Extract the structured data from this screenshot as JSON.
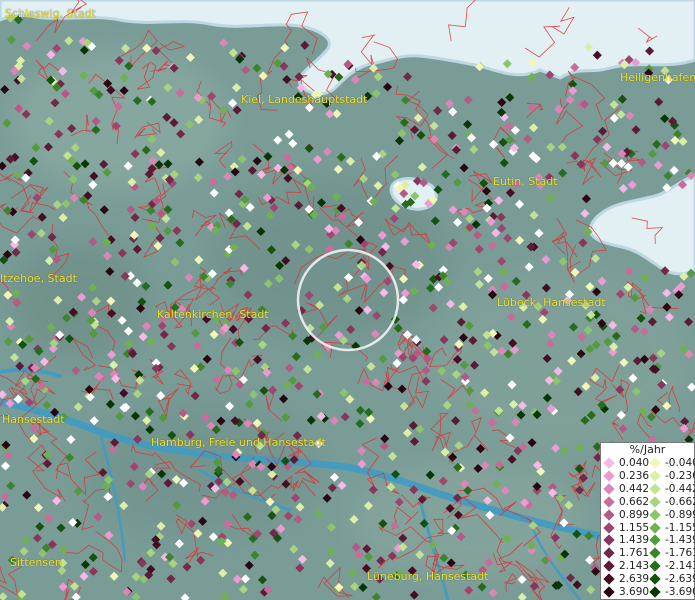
{
  "map": {
    "places": [
      {
        "name": "Schleswig, Stadt"
      },
      {
        "name": "Heiligenhafen, Stadt"
      },
      {
        "name": "Kiel, Landeshauptstadt"
      },
      {
        "name": "Eutin, Stadt"
      },
      {
        "name": "Itzehoe, Stadt"
      },
      {
        "name": "Lübeck, Hansestadt"
      },
      {
        "name": "Kaltenkirchen, Stadt"
      },
      {
        "name": "Hansestadt"
      },
      {
        "name": "Hamburg, Freie und Hansestadt"
      },
      {
        "name": "Sittensen"
      },
      {
        "name": "Lüneburg, Hansestadt"
      }
    ]
  },
  "legend": {
    "title": "%/Jahr",
    "positive": [
      {
        "label": "0.040",
        "color": "#f6b8e6"
      },
      {
        "label": "0.236",
        "color": "#ee9ad2"
      },
      {
        "label": "0.442",
        "color": "#dc86b8"
      },
      {
        "label": "0.662",
        "color": "#c86c9c"
      },
      {
        "label": "0.899",
        "color": "#b45a86"
      },
      {
        "label": "1.155",
        "color": "#9e4670"
      },
      {
        "label": "1.439",
        "color": "#88365c"
      },
      {
        "label": "1.761",
        "color": "#722848"
      },
      {
        "label": "2.143",
        "color": "#5c1a36"
      },
      {
        "label": "2.639",
        "color": "#440e24"
      },
      {
        "label": "3.690",
        "color": "#2a0612"
      }
    ],
    "negative": [
      {
        "label": "-0.040",
        "color": "#f2f6b6"
      },
      {
        "label": "-0.236",
        "color": "#dcefa6"
      },
      {
        "label": "-0.442",
        "color": "#c2e296"
      },
      {
        "label": "-0.662",
        "color": "#a8d482"
      },
      {
        "label": "-0.899",
        "color": "#8cc46c"
      },
      {
        "label": "-1.155",
        "color": "#70b054"
      },
      {
        "label": "-1.439",
        "color": "#549a3e"
      },
      {
        "label": "-1.761",
        "color": "#3c842c"
      },
      {
        "label": "-2.143",
        "color": "#266c1c"
      },
      {
        "label": "-2.639",
        "color": "#14520e"
      },
      {
        "label": "-3.690",
        "color": "#063604"
      }
    ]
  }
}
